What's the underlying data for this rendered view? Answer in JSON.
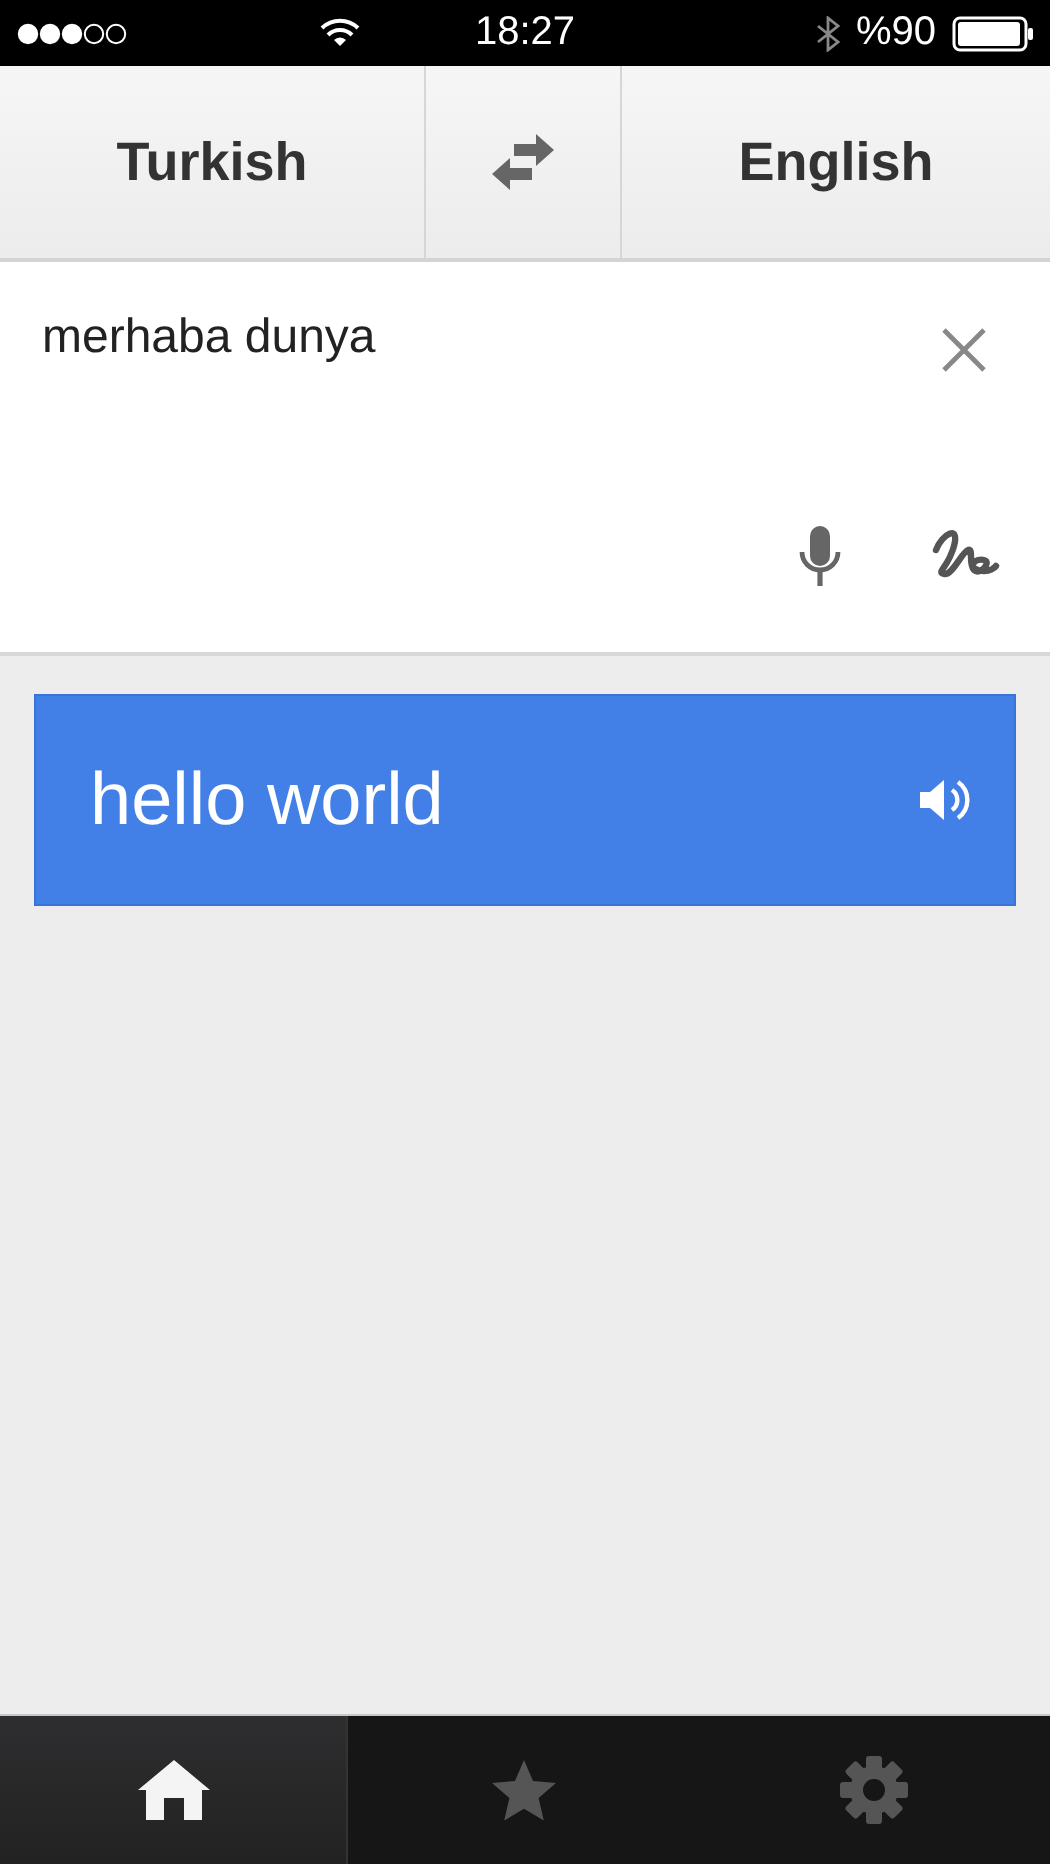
{
  "status_bar": {
    "time": "18:27",
    "battery": "%90"
  },
  "languages": {
    "source": "Turkish",
    "target": "English"
  },
  "input": {
    "value": "merhaba dunya"
  },
  "result": {
    "text": "hello world"
  },
  "tab_bar": [
    {
      "kind": "home",
      "selected": true
    },
    {
      "kind": "favorites",
      "selected": false
    },
    {
      "kind": "settings",
      "selected": false
    }
  ]
}
